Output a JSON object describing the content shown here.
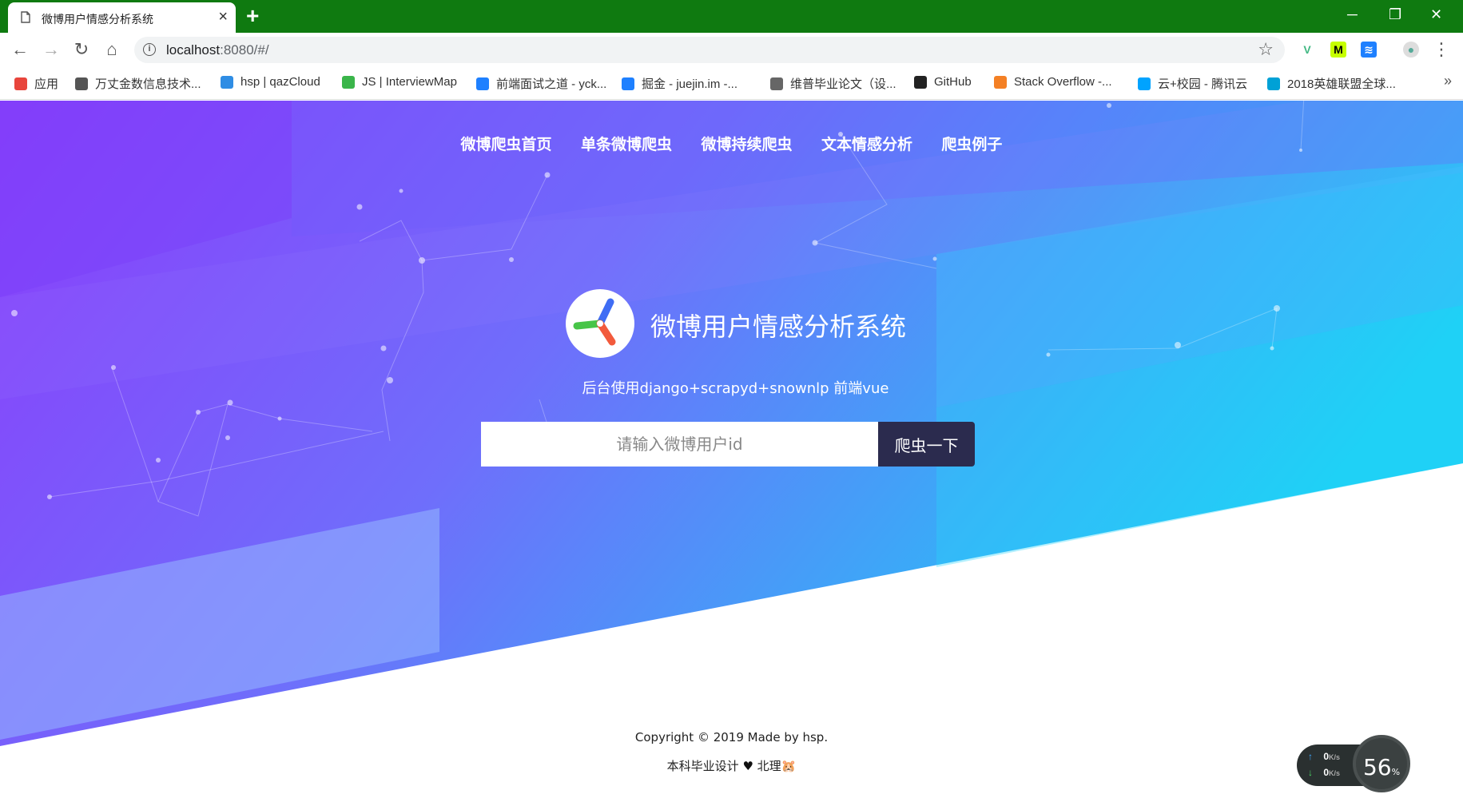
{
  "browser": {
    "tab_title": "微博用户情感分析系统",
    "url_host": "localhost",
    "url_rest": ":8080/#/",
    "bookmarks": [
      {
        "label": "应用",
        "icon": "apps-grid-icon",
        "color": "#e8453c"
      },
      {
        "label": "万丈金数信息技术...",
        "icon": "aws-icon",
        "color": "#555555"
      },
      {
        "label": "hsp | qazCloud",
        "icon": "cloud-icon",
        "color": "#2f8de4"
      },
      {
        "label": "JS | InterviewMap",
        "icon": "interviewmap-icon",
        "color": "#3ab54a"
      },
      {
        "label": "前端面试之道 - yck...",
        "icon": "juejin-icon",
        "color": "#1e80ff"
      },
      {
        "label": "掘金 - juejin.im -...",
        "icon": "juejin-icon",
        "color": "#1e80ff"
      },
      {
        "label": "维普毕业论文（设...",
        "icon": "document-icon",
        "color": "#666666"
      },
      {
        "label": "GitHub",
        "icon": "github-icon",
        "color": "#222222"
      },
      {
        "label": "Stack Overflow -...",
        "icon": "stackoverflow-icon",
        "color": "#f48024"
      },
      {
        "label": "云+校园 - 腾讯云",
        "icon": "tencent-cloud-icon",
        "color": "#00a3ff"
      },
      {
        "label": "2018英雄联盟全球...",
        "icon": "bilibili-icon",
        "color": "#00a1d6"
      }
    ]
  },
  "nav": {
    "items": [
      "微博爬虫首页",
      "单条微博爬虫",
      "微博持续爬虫",
      "文本情感分析",
      "爬虫例子"
    ]
  },
  "hero": {
    "title": "微博用户情感分析系统",
    "subtitle": "后台使用django+scrapyd+snownlp 前端vue",
    "search_placeholder": "请输入微博用户id",
    "search_button": "爬虫一下"
  },
  "footer": {
    "copyright": "Copyright © 2019 Made by hsp.",
    "credit_prefix": "本科毕业设计",
    "heart": "♥",
    "credit_suffix": "北理🐹"
  },
  "speed_widget": {
    "upload": "0",
    "upload_unit": "K/s",
    "download": "0",
    "download_unit": "K/s",
    "percent": "56",
    "percent_unit": "%"
  },
  "colors": {
    "titlebar": "#0f7a10",
    "hero_left": "#8b3dfb",
    "hero_right": "#19d0f5",
    "search_button_bg": "#2b2b4e"
  }
}
